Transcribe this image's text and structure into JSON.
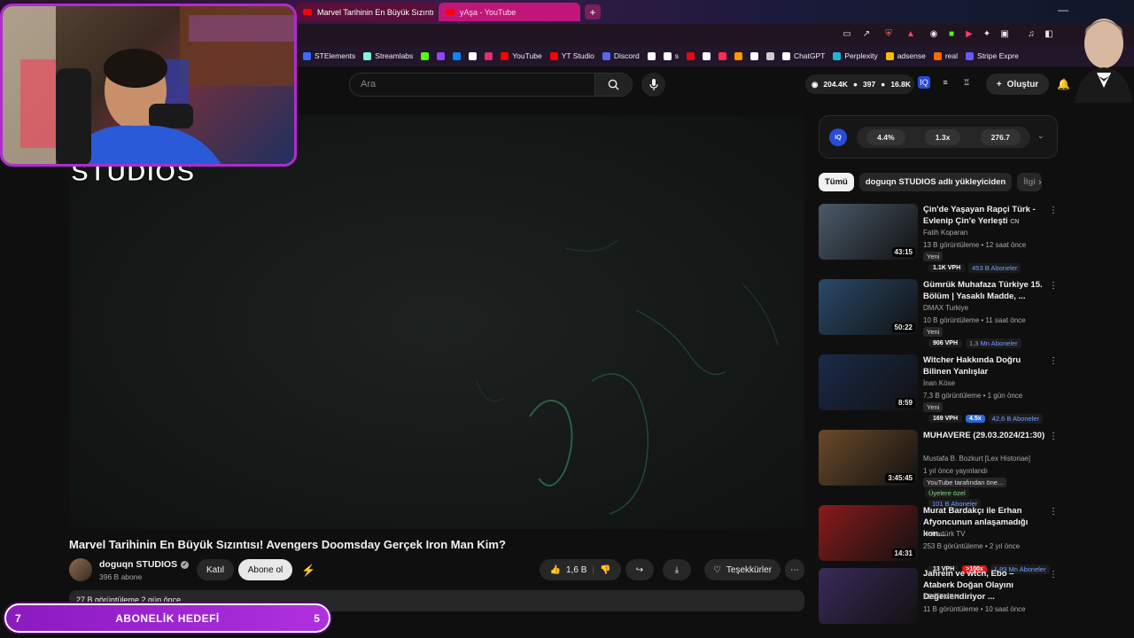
{
  "browser": {
    "tabs": [
      {
        "label": "Marvel Tarihinin En Büyük Sızıntı"
      },
      {
        "label": "yAşa - YouTube"
      }
    ],
    "newtab": "+",
    "minimize": "—"
  },
  "bookmarks": [
    {
      "label": "STElements",
      "color": "#3a6cff"
    },
    {
      "label": "Streamlabs",
      "color": "#80f5d2"
    },
    {
      "label": "",
      "color": "#53fc18"
    },
    {
      "label": "",
      "color": "#9146ff"
    },
    {
      "label": "",
      "color": "#1185fe"
    },
    {
      "label": "",
      "color": "#ffffff"
    },
    {
      "label": "",
      "color": "#e1306c"
    },
    {
      "label": "YouTube",
      "color": "#ff0000"
    },
    {
      "label": "YT Studio",
      "color": "#ff0000"
    },
    {
      "label": "Discord",
      "color": "#5865f2"
    },
    {
      "label": "",
      "color": "#ffffff"
    },
    {
      "label": "s",
      "color": "#ffffff"
    },
    {
      "label": "",
      "color": "#e50914"
    },
    {
      "label": "",
      "color": "#ffffff"
    },
    {
      "label": "",
      "color": "#ff2d55"
    },
    {
      "label": "",
      "color": "#ff9900"
    },
    {
      "label": "",
      "color": "#ffffff"
    },
    {
      "label": "",
      "color": "#cccccc"
    },
    {
      "label": "ChatGPT",
      "color": "#ffffff"
    },
    {
      "label": "Perplexity",
      "color": "#20b8cd"
    },
    {
      "label": "adsense",
      "color": "#fbbc04"
    },
    {
      "label": "real",
      "color": "#ff6a00"
    },
    {
      "label": "Stripe Expre",
      "color": "#635bff"
    }
  ],
  "header": {
    "search_placeholder": "Ara",
    "stats": {
      "views": "204.4K",
      "likes": "397",
      "subs": "16.8K"
    },
    "create_label": "Oluştur"
  },
  "player": {
    "overlay_text": "STUDIOS"
  },
  "video": {
    "title": "Marvel Tarihinin En Büyük Sızıntısı! Avengers Doomsday Gerçek Iron Man Kim?",
    "channel": "doguqn STUDIOS",
    "subscribers": "396 B abone",
    "join_label": "Katıl",
    "subscribe_label": "Abone ol",
    "likes": "1,6 B",
    "thanks_label": "Teşekkürler",
    "description_preview": "27 B görüntüleme  2 gün önce"
  },
  "iq_panel": {
    "badge": "IQ",
    "values": [
      "4.4%",
      "1.3x",
      "276.7"
    ]
  },
  "chips": [
    "Tümü",
    "doguqn STUDIOS adlı yükleyiciden",
    "İlgi"
  ],
  "recommendations": [
    {
      "title": "Çin'de Yaşayan Rapçi Türk - Evlenip Çin'e Yerleşti",
      "title_suffix": "CN",
      "channel": "Fatih Koparan",
      "meta": "13 B görüntüleme • 12 saat önce",
      "badge": "Yeni",
      "duration": "43:15",
      "vph": "1.1K VPH",
      "ratio": "",
      "subs": "453 B Aboneler",
      "thumb_color": "#4a5a6a"
    },
    {
      "title": "Gümrük Muhafaza Türkiye 15. Bölüm | Yasaklı Madde, ...",
      "title_suffix": "",
      "channel": "DMAX Turkiye",
      "meta": "10 B görüntüleme • 11 saat önce",
      "badge": "Yeni",
      "duration": "50:22",
      "vph": "906 VPH",
      "ratio": "",
      "subs": "1,3 Mn Aboneler",
      "thumb_color": "#2a4a6a"
    },
    {
      "title": "Witcher Hakkında Doğru Bilinen Yanlışlar",
      "title_suffix": "",
      "channel": "İnan Köse",
      "meta": "7,3 B görüntüleme • 1 gün önce",
      "badge": "Yeni",
      "duration": "8:59",
      "vph": "169 VPH",
      "ratio": "4.5x",
      "ratio_color": "#2a6cd8",
      "subs": "42,6 B Aboneler",
      "thumb_color": "#1a2a4a"
    },
    {
      "title": "MUHAVERE (29.03.2024/21:30)",
      "title_suffix": "",
      "channel": "Mustafa B. Bozkurt [Lex Historiae]",
      "meta": "1 yıl önce yayınlandı",
      "badge": "YouTube tarafından öne...",
      "members": "Üyelere özel",
      "duration": "3:45:45",
      "vph": "",
      "ratio": "",
      "subs": "101 B Aboneler",
      "thumb_color": "#6a4a2a"
    },
    {
      "title": "Murat Bardakçı ile Erhan Afyoncunun anlaşamadığı kon...",
      "title_suffix": "",
      "channel": "Habertürk TV",
      "meta": "253 B görüntüleme • 2 yıl önce",
      "badge": "",
      "duration": "14:31",
      "vph": "13 VPH",
      "ratio": ">100x",
      "ratio_color": "#d81a1a",
      "subs": "1,89 Mn Aboneler",
      "thumb_color": "#8a1a1a"
    },
    {
      "title": "Jahrein ve wtcn, Ebo – Ataberk Doğan Olayını Değerlendiriyor ...",
      "title_suffix": "",
      "channel": "KESİTMEN",
      "meta": "11 B görüntüleme • 10 saat önce",
      "badge": "",
      "duration": "",
      "vph": "",
      "ratio": "",
      "subs": "",
      "thumb_color": "#3a2a5a"
    }
  ],
  "goal": {
    "left_value": "7",
    "label": "ABONELİK HEDEFİ",
    "right_value": "5"
  }
}
